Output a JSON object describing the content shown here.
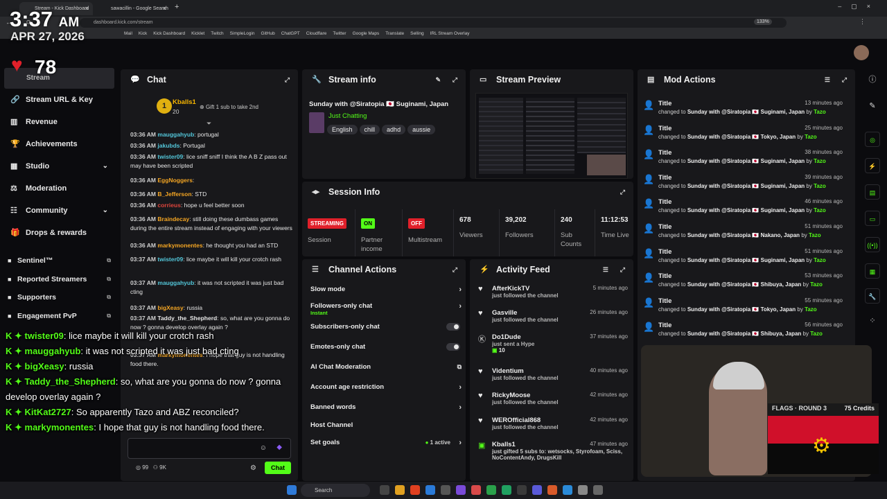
{
  "browser": {
    "tabs": [
      {
        "title": "Stream - Kick Dashboard"
      },
      {
        "title": "sawacillin - Google Search"
      }
    ],
    "url": "dashboard.kick.com/stream",
    "zoom": "133%",
    "bookmarks": [
      "Mail",
      "Kick",
      "Kick Dashboard",
      "Kicklet",
      "Twitch",
      "SimpleLogin",
      "GitHub",
      "ChatGPT",
      "Cloudflare",
      "Twitter",
      "Google Maps",
      "Translate",
      "Selling",
      "IRL Stream Overlay"
    ]
  },
  "overlay_clock": {
    "time": "3:37",
    "ampm": "AM",
    "date": "APR 27, 2026",
    "heart_rate": "78"
  },
  "sidebar": {
    "current": "Stream",
    "items": [
      {
        "label": "Stream URL & Key",
        "icon": "link-icon"
      },
      {
        "label": "Revenue",
        "icon": "chart-icon"
      },
      {
        "label": "Achievements",
        "icon": "trophy-icon"
      },
      {
        "label": "Studio",
        "icon": "film-icon",
        "chevron": true
      },
      {
        "label": "Moderation",
        "icon": "gavel-icon"
      },
      {
        "label": "Community",
        "icon": "community-icon",
        "chevron": true
      },
      {
        "label": "Drops & rewards",
        "icon": "gift-icon"
      }
    ],
    "ext_items": [
      {
        "label": "Sentinel™"
      },
      {
        "label": "Reported Streamers"
      },
      {
        "label": "Supporters"
      },
      {
        "label": "Engagement PvP"
      }
    ]
  },
  "chat": {
    "title": "Chat",
    "pinned": {
      "user": "Kballs1",
      "count": "20",
      "gift_text": "Gift 1 sub to take 2nd"
    },
    "messages": [
      {
        "time": "03:36 AM",
        "user": "mauggahyub",
        "color": "#53c6d9",
        "text": "portugal"
      },
      {
        "time": "03:36 AM",
        "user": "jakubds",
        "color": "#53c6d9",
        "text": "Portugal"
      },
      {
        "time": "03:36 AM",
        "user": "twister09",
        "color": "#53c6d9",
        "text": "lice sniff sniff I think the A B Z pass out may have been scripted"
      },
      {
        "time": "03:36 AM",
        "user": "EggNoggers",
        "color": "#f5a623",
        "text": ""
      },
      {
        "time": "03:36 AM",
        "user": "B_Jefferson",
        "color": "#f5a623",
        "text": "STD"
      },
      {
        "time": "03:36 AM",
        "user": "corrieus",
        "color": "#e0453c",
        "text": "hope u feel better soon"
      },
      {
        "time": "03:36 AM",
        "user": "Braindecay",
        "color": "#f5a623",
        "text": "still doing these dumbass games during the entire stream instead of engaging with your viewers"
      },
      {
        "time": "03:36 AM",
        "user": "markymonentes",
        "color": "#f5a623",
        "text": "he thought you had an STD"
      },
      {
        "time": "03:37 AM",
        "user": "twister09",
        "color": "#53c6d9",
        "text": "lice maybe it will kill your crotch rash"
      },
      {
        "time": "03:37 AM",
        "user": "mauggahyub",
        "color": "#53c6d9",
        "text": "it was not scripted it was just bad cting"
      },
      {
        "time": "03:37 AM",
        "user": "bigXeasy",
        "color": "#f5a623",
        "text": "russia"
      },
      {
        "time": "03:37 AM",
        "user": "Taddy_the_Shepherd",
        "color": "#e6e6e6",
        "text": "so, what are you gonna do now ? gonna develop overlay again ?"
      },
      {
        "time": "03:37 AM",
        "user": "KitKat2727",
        "color": "#f5a623",
        "text": "So apparently Tazo and ABZ reconciled?"
      },
      {
        "time": "03:37 AM",
        "user": "markymonentes",
        "color": "#f5a623",
        "text": "I hope that guy is not handling food there."
      }
    ],
    "send_button": "Chat",
    "bottom_counts": [
      "99",
      "9K"
    ]
  },
  "stream_info": {
    "title": "Stream info",
    "stream_title": "Sunday with @Siratopia 🇯🇵 Suginami, Japan",
    "category": "Just Chatting",
    "tags": [
      "English",
      "chill",
      "adhd",
      "aussie"
    ]
  },
  "stream_preview": {
    "title": "Stream Preview"
  },
  "session": {
    "title": "Session Info",
    "cells": [
      {
        "badge": "STREAMING",
        "badge_color": "#e0202a",
        "label": "Session"
      },
      {
        "badge": "ON",
        "badge_color": "#53fc18",
        "label": "Partner income"
      },
      {
        "badge": "OFF",
        "badge_color": "#e0202a",
        "label": "Multistream"
      },
      {
        "value": "678",
        "label": "Viewers"
      },
      {
        "value": "39,202",
        "label": "Followers"
      },
      {
        "value": "240",
        "label": "Sub Counts"
      },
      {
        "value": "11:12:53",
        "label": "Time Live"
      }
    ]
  },
  "channel_actions": {
    "title": "Channel Actions",
    "items": [
      {
        "label": "Slow mode",
        "control": "arrow"
      },
      {
        "label": "Followers-only chat",
        "sub": "Instant",
        "control": "arrow"
      },
      {
        "label": "Subscribers-only chat",
        "control": "toggle"
      },
      {
        "label": "Emotes-only chat",
        "control": "toggle"
      },
      {
        "label": "AI Chat Moderation",
        "control": "ext"
      },
      {
        "label": "Account age restriction",
        "control": "arrow"
      },
      {
        "label": "Banned words",
        "control": "arrow"
      },
      {
        "label": "Host Channel",
        "control": "none"
      },
      {
        "label": "Set goals",
        "status": "1 active",
        "control": "arrow"
      }
    ]
  },
  "activity": {
    "title": "Activity Feed",
    "items": [
      {
        "name": "AfterKickTV",
        "sub": "just followed the channel",
        "time": "5 minutes ago",
        "icon": "heart-icon"
      },
      {
        "name": "Gasville",
        "sub": "just followed the channel",
        "time": "26 minutes ago",
        "icon": "heart-icon"
      },
      {
        "name": "Do1Dude",
        "sub": "just sent a Hype",
        "extra": "10",
        "time": "37 minutes ago",
        "icon": "kick-icon"
      },
      {
        "name": "Videntium",
        "sub": "just followed the channel",
        "time": "40 minutes ago",
        "icon": "heart-icon"
      },
      {
        "name": "RickyMoose",
        "sub": "just followed the channel",
        "time": "42 minutes ago",
        "icon": "heart-icon"
      },
      {
        "name": "WEROfficial868",
        "sub": "just followed the channel",
        "time": "42 minutes ago",
        "icon": "heart-icon"
      },
      {
        "name": "Kballs1",
        "sub": "just gifted 5 subs to: wetsocks, Styrofoam, Sciss, NoContentAndy, DrugsKill",
        "time": "47 minutes ago",
        "icon": "gift-icon"
      }
    ]
  },
  "mod_actions": {
    "title": "Mod Actions",
    "items": [
      {
        "title": "Title",
        "desc": "Sunday with @Siratopia 🇯🇵 Suginami, Japan",
        "by": "Tazo",
        "time": "13 minutes ago"
      },
      {
        "title": "Title",
        "desc": "Sunday with @Siratopia 🇯🇵 Tokyo, Japan",
        "by": "Tazo",
        "time": "25 minutes ago"
      },
      {
        "title": "Title",
        "desc": "Sunday with @Siratopia 🇯🇵 Suginami, Japan",
        "by": "Tazo",
        "time": "38 minutes ago"
      },
      {
        "title": "Title",
        "desc": "Sunday with @Siratopia 🇯🇵 Suginami, Japan",
        "by": "Tazo",
        "time": "39 minutes ago"
      },
      {
        "title": "Title",
        "desc": "Sunday with @Siratopia 🇯🇵 Suginami, Japan",
        "by": "Tazo",
        "time": "46 minutes ago"
      },
      {
        "title": "Title",
        "desc": "Sunday with @Siratopia 🇯🇵 Nakano, Japan",
        "by": "Tazo",
        "time": "51 minutes ago"
      },
      {
        "title": "Title",
        "desc": "Sunday with @Siratopia 🇯🇵 Suginami, Japan",
        "by": "Tazo",
        "time": "51 minutes ago"
      },
      {
        "title": "Title",
        "desc": "Sunday with @Siratopia 🇯🇵 Shibuya, Japan",
        "by": "Tazo",
        "time": "53 minutes ago"
      },
      {
        "title": "Title",
        "desc": "Sunday with @Siratopia 🇯🇵 Tokyo, Japan",
        "by": "Tazo",
        "time": "55 minutes ago"
      },
      {
        "title": "Title",
        "desc": "Sunday with @Siratopia 🇯🇵 Shibuya, Japan",
        "by": "Tazo",
        "time": "56 minutes ago"
      }
    ],
    "changed_to": "changed to",
    "by_word": "by"
  },
  "flags_game": {
    "label": "FLAGS · ROUND 3",
    "credits": "75 Credits"
  },
  "overlay_chat": [
    {
      "user": "twister09",
      "text": "lice maybe it will kill your crotch rash"
    },
    {
      "user": "mauggahyub",
      "text": "it was not scripted it was just bad cting"
    },
    {
      "user": "bigXeasy",
      "text": "russia"
    },
    {
      "user": "Taddy_the_Shepherd",
      "text": "so, what are you gonna do now ? gonna develop overlay again ?"
    },
    {
      "user": "KitKat2727",
      "text": "So apparently Tazo and ABZ reconciled?"
    },
    {
      "user": "markymonentes",
      "text": "I hope that guy is not handling food there."
    }
  ],
  "taskbar": {
    "search_label": "Search"
  },
  "colors": {
    "accent": "#53fc18",
    "panel": "#18181b",
    "bg": "#0b0b0e"
  }
}
